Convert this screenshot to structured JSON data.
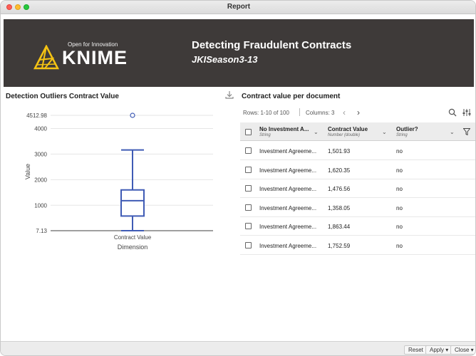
{
  "window": {
    "title": "Report"
  },
  "banner": {
    "logo_tagline": "Open for Innovation",
    "logo_text": "KNIME",
    "title": "Detecting Fraudulent Contracts",
    "subtitle": "JKISeason3-13"
  },
  "chart_panel": {
    "title": "Detection Outliers Contract Value"
  },
  "chart_data": {
    "type": "boxplot",
    "title": "",
    "xlabel": "Dimension",
    "ylabel": "Value",
    "categories": [
      "Contract Value"
    ],
    "y_ticks": [
      "7.13",
      "1000",
      "2000",
      "3000",
      "4000",
      "4512.98"
    ],
    "ylim": [
      7.13,
      4512.98
    ],
    "series": [
      {
        "min": 7.13,
        "q1": 580,
        "median": 1180,
        "q3": 1600,
        "max": 3160,
        "outliers": [
          4512.98
        ]
      }
    ],
    "color": "#3f5bb5",
    "grid": true
  },
  "table_panel": {
    "title": "Contract value per document",
    "rows_info": "Rows: 1-10 of 100",
    "cols_info": "Columns: 3",
    "columns": [
      {
        "name": "No Investment A...",
        "type": "String"
      },
      {
        "name": "Contract Value",
        "type": "Number (double)"
      },
      {
        "name": "Outlier?",
        "type": "String"
      }
    ],
    "rows": [
      [
        "Investment Agreeme...",
        "1,501.93",
        "no"
      ],
      [
        "Investment Agreeme...",
        "1,620.35",
        "no"
      ],
      [
        "Investment Agreeme...",
        "1,476.56",
        "no"
      ],
      [
        "Investment Agreeme...",
        "1,358.05",
        "no"
      ],
      [
        "Investment Agreeme...",
        "1,863.44",
        "no"
      ],
      [
        "Investment Agreeme...",
        "1,752.59",
        "no"
      ]
    ]
  },
  "footer": {
    "reset_label": "Reset",
    "apply_label": "Apply ▾",
    "close_label": "Close ▾"
  }
}
